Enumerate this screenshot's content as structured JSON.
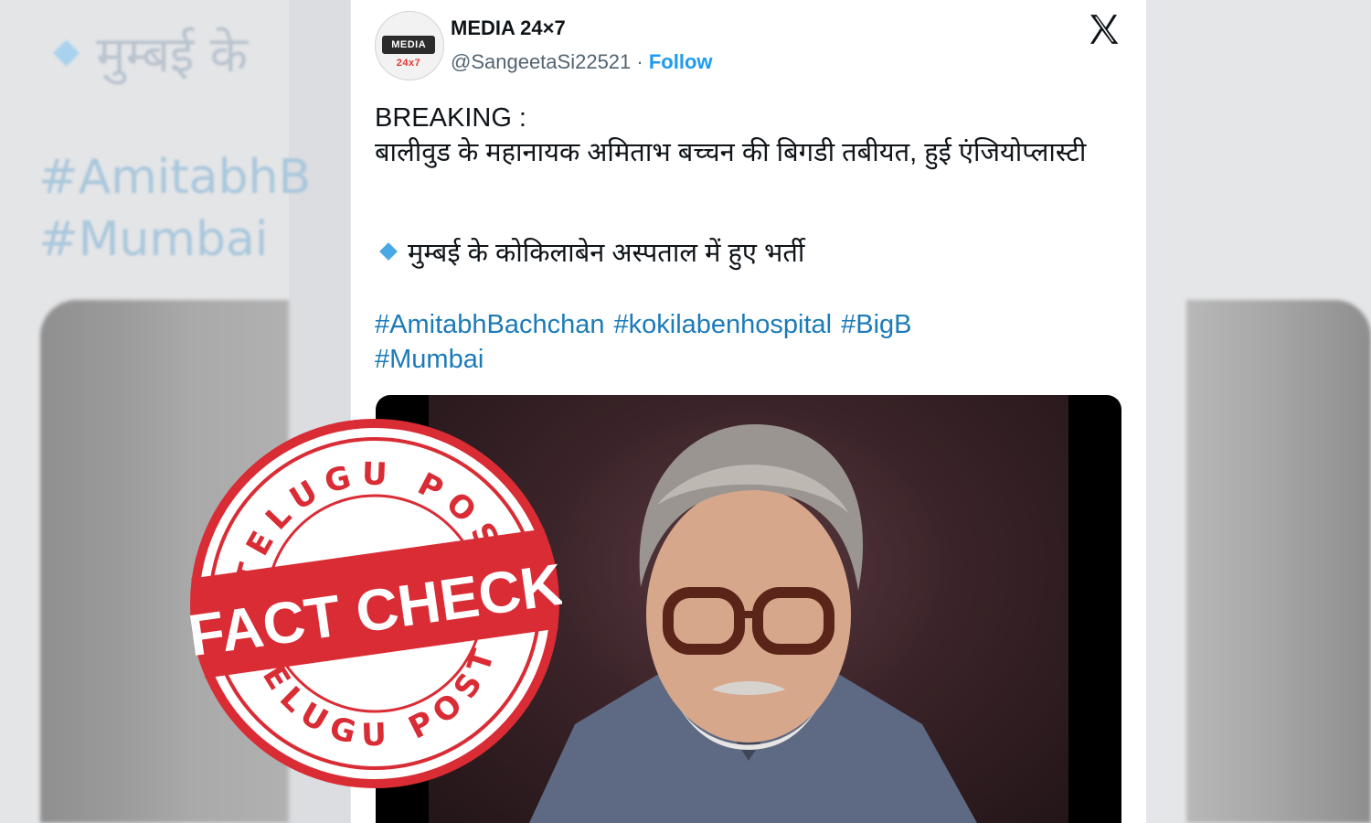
{
  "background": {
    "line1": "मुम्बई के",
    "line2": "#AmitabhB",
    "line3": "#Mumbai"
  },
  "tweet": {
    "display_name": "MEDIA 24×7",
    "handle": "@SangeetaSi22521",
    "separator": " · ",
    "follow_label": "Follow",
    "avatar_logo": {
      "main": "MEDIA",
      "accent": "24x7"
    },
    "text_line1": "BREAKING :",
    "text_line2": "बालीवुड के महानायक अमिताभ बच्चन की बिगडी तबीयत, हुई एंजियोप्लास्टी",
    "bullet_text": "मुम्बई के कोकिलाबेन अस्पताल में हुए भर्ती",
    "hashtags": [
      "#AmitabhBachchan",
      "#kokilabenhospital",
      "#BigB",
      "#Mumbai"
    ]
  },
  "stamp": {
    "top_text": "TELUGU POST",
    "bottom_text": "TELUGU POST",
    "main_text": "FACT CHECK",
    "color": "#d92c35"
  },
  "colors": {
    "link": "#1d9bf0",
    "hashtag": "#1b7bb8",
    "bullet": "#4aa8e6"
  },
  "icons": [
    "x-logo-icon",
    "diamond-bullet-icon"
  ]
}
